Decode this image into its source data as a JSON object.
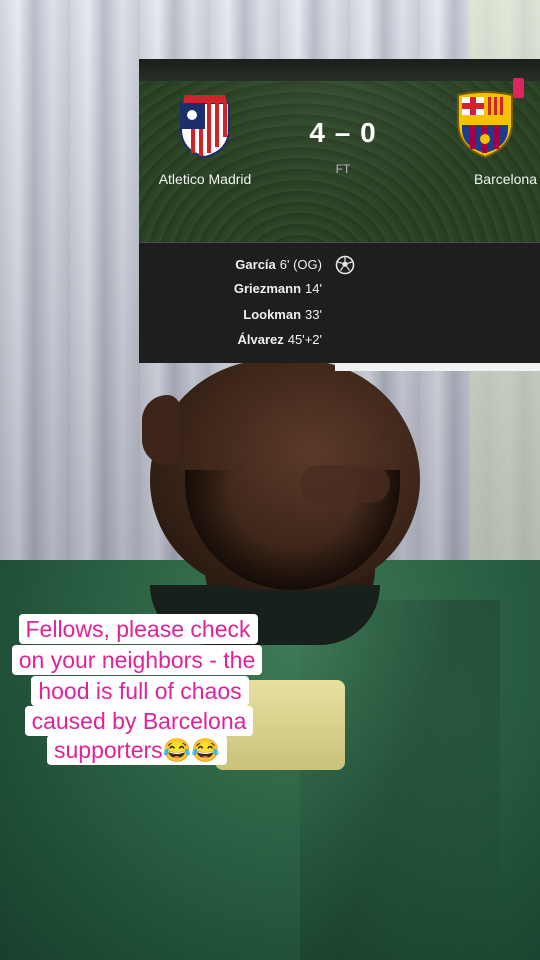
{
  "match": {
    "home_team": "Atletico Madrid",
    "away_team": "Barcelona",
    "score": "4 – 0",
    "status": "FT",
    "home_crest_icon": "atletico-madrid-crest",
    "away_crest_icon": "fc-barcelona-crest",
    "red_card_icon": "red-card-icon",
    "scorers": [
      {
        "player": "García",
        "minute": "6' (OG)"
      },
      {
        "player": "Griezmann",
        "minute": "14'"
      },
      {
        "player": "Lookman",
        "minute": "33'"
      },
      {
        "player": "Álvarez",
        "minute": "45'+2'"
      }
    ],
    "goal_icon": "soccer-ball-icon"
  },
  "caption": {
    "lines": [
      "Fellows, please check",
      "on your neighbors - the",
      "hood is full of chaos",
      "caused by Barcelona",
      "supporters😂😂"
    ],
    "text_color": "#e0229a",
    "background_color": "#ffffff"
  },
  "colors": {
    "card_dark": "#1e1e1e",
    "card_green": "#2a3f25",
    "red_card": "#e0245e"
  }
}
